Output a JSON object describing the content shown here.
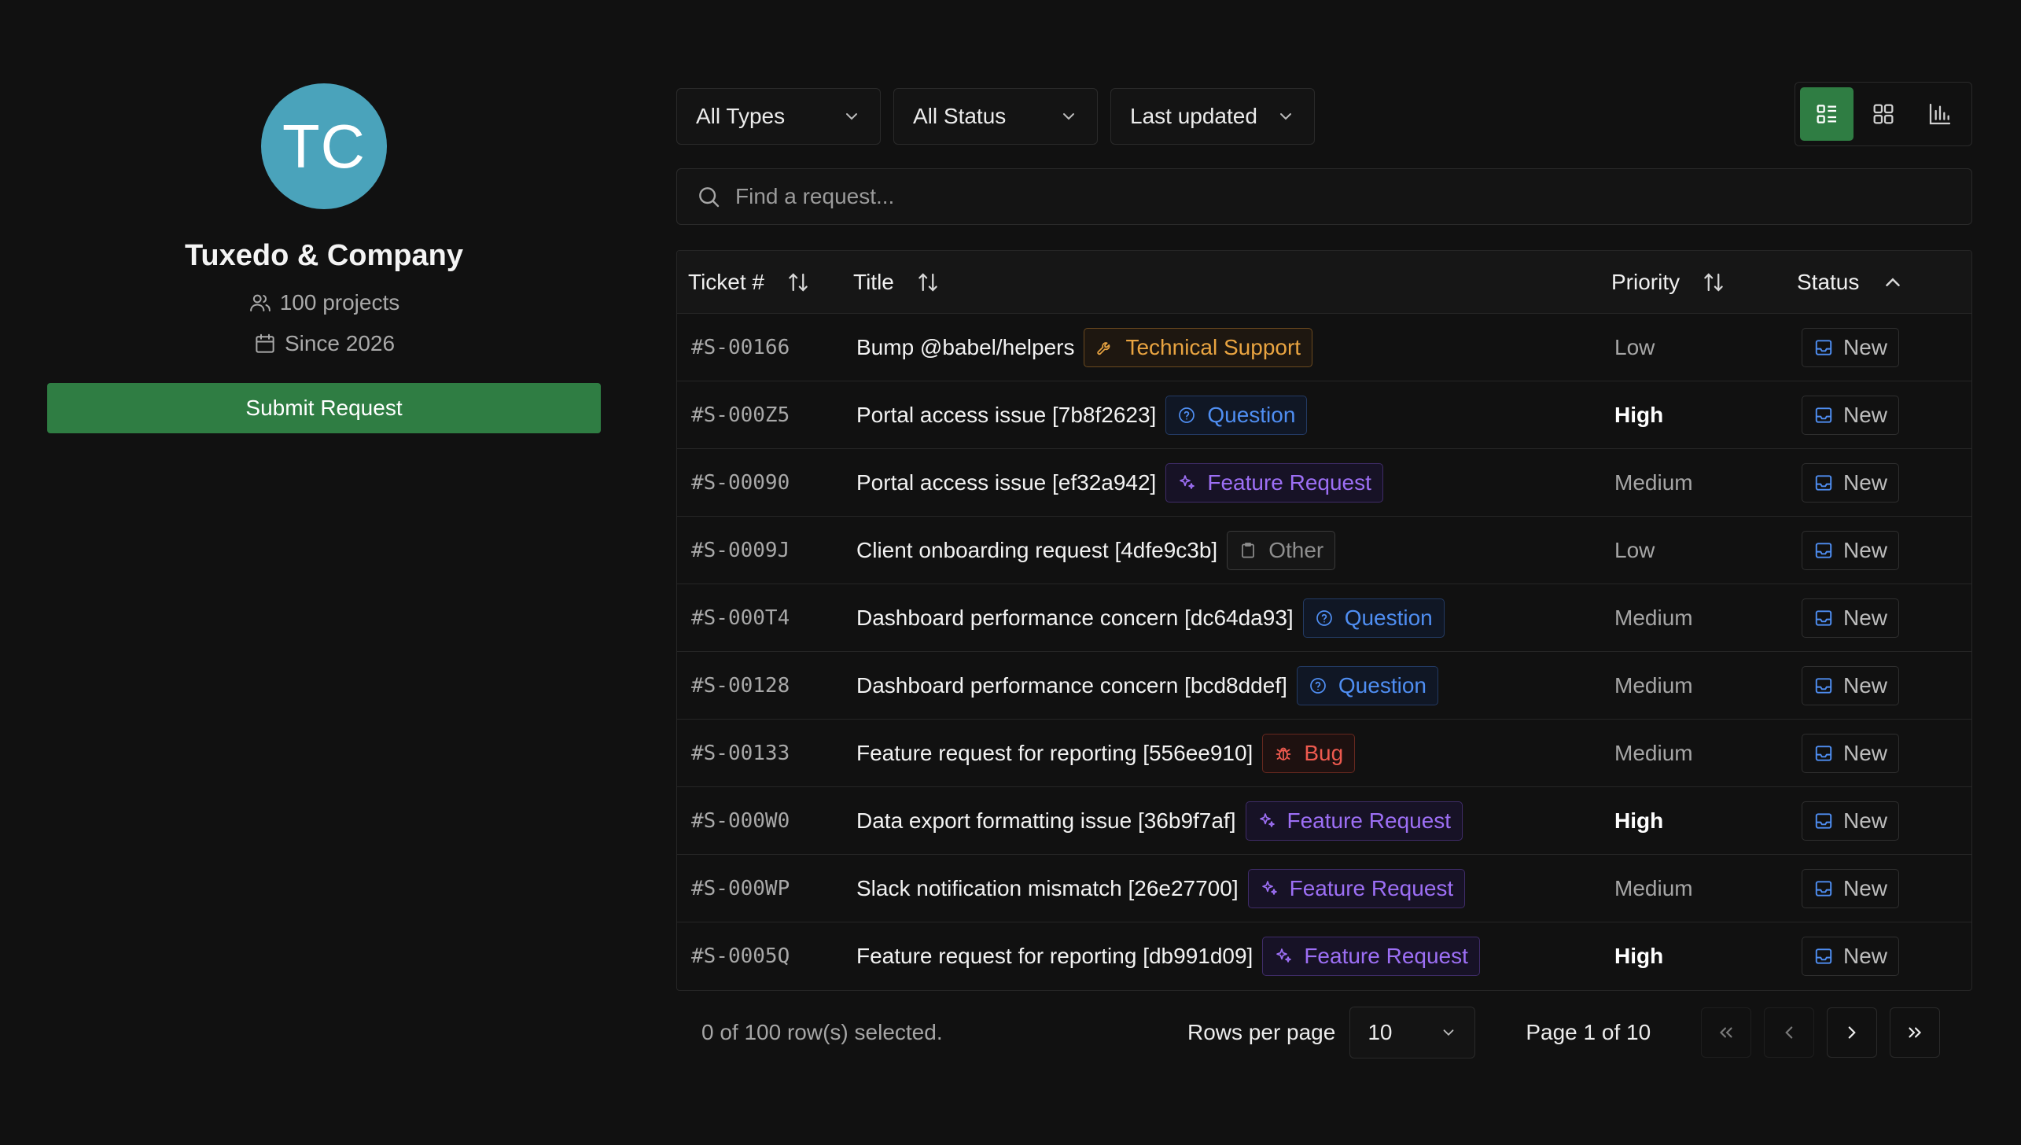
{
  "profile": {
    "initials": "TC",
    "avatar_color": "#4aa3bb",
    "company": "Tuxedo & Company",
    "projects": "100 projects",
    "since": "Since 2026",
    "submit_label": "Submit Request"
  },
  "filters": {
    "type": "All Types",
    "status": "All Status",
    "sort": "Last updated"
  },
  "views": [
    "list-view-icon",
    "grid-view-icon",
    "chart-view-icon"
  ],
  "search": {
    "placeholder": "Find a request...",
    "value": ""
  },
  "table": {
    "headers": {
      "ticket": "Ticket #",
      "title": "Title",
      "priority": "Priority",
      "status": "Status"
    },
    "rows": [
      {
        "ticket": "#S-00166",
        "title": "Bump @babel/helpers",
        "type": "Technical Support",
        "kind": "tech",
        "priority": "Low",
        "status": "New"
      },
      {
        "ticket": "#S-000Z5",
        "title": "Portal access issue [7b8f2623]",
        "type": "Question",
        "kind": "question",
        "priority": "High",
        "status": "New"
      },
      {
        "ticket": "#S-00090",
        "title": "Portal access issue [ef32a942]",
        "type": "Feature Request",
        "kind": "feature",
        "priority": "Medium",
        "status": "New"
      },
      {
        "ticket": "#S-0009J",
        "title": "Client onboarding request [4dfe9c3b]",
        "type": "Other",
        "kind": "other",
        "priority": "Low",
        "status": "New"
      },
      {
        "ticket": "#S-000T4",
        "title": "Dashboard performance concern [dc64da93]",
        "type": "Question",
        "kind": "question",
        "priority": "Medium",
        "status": "New"
      },
      {
        "ticket": "#S-00128",
        "title": "Dashboard performance concern [bcd8ddef]",
        "type": "Question",
        "kind": "question",
        "priority": "Medium",
        "status": "New"
      },
      {
        "ticket": "#S-00133",
        "title": "Feature request for reporting [556ee910]",
        "type": "Bug",
        "kind": "bug",
        "priority": "Medium",
        "status": "New"
      },
      {
        "ticket": "#S-000W0",
        "title": "Data export formatting issue [36b9f7af]",
        "type": "Feature Request",
        "kind": "feature",
        "priority": "High",
        "status": "New"
      },
      {
        "ticket": "#S-000WP",
        "title": "Slack notification mismatch [26e27700]",
        "type": "Feature Request",
        "kind": "feature",
        "priority": "Medium",
        "status": "New"
      },
      {
        "ticket": "#S-0005Q",
        "title": "Feature request for reporting [db991d09]",
        "type": "Feature Request",
        "kind": "feature",
        "priority": "High",
        "status": "New"
      }
    ]
  },
  "footer": {
    "selected": "0 of 100 row(s) selected.",
    "rows_per_page_label": "Rows per page",
    "rows_per_page": "10",
    "page_info": "Page 1 of 10"
  }
}
